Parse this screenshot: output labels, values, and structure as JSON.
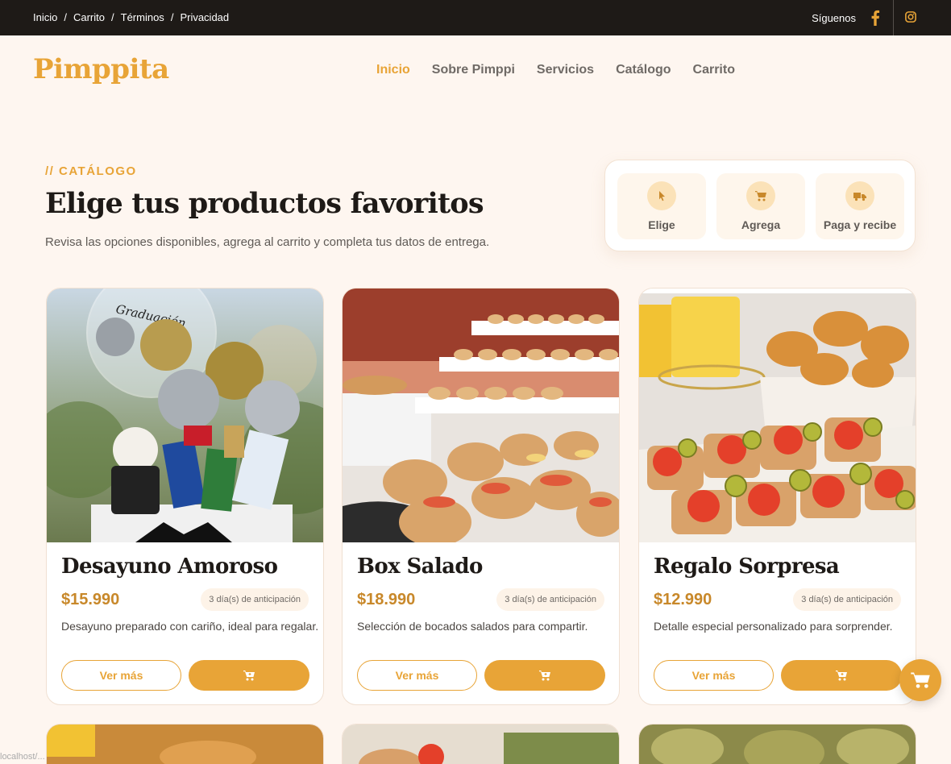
{
  "topbar": {
    "breadcrumbs": [
      "Inicio",
      "Carrito",
      "Términos",
      "Privacidad"
    ],
    "follow_label": "Síguenos",
    "social_icons": [
      "facebook-icon",
      "instagram-icon"
    ]
  },
  "brand": {
    "name": "Pimppita"
  },
  "nav": {
    "items": [
      "Inicio",
      "Sobre Pimppi",
      "Servicios",
      "Catálogo",
      "Carrito"
    ],
    "active": "Inicio"
  },
  "hero": {
    "eyebrow": "// CATÁLOGO",
    "title": "Elige tus productos favoritos",
    "subtitle": "Revisa las opciones disponibles, agrega al carrito y completa tus datos de entrega."
  },
  "steps": [
    {
      "label": "Elige",
      "icon": "pointer-icon"
    },
    {
      "label": "Agrega",
      "icon": "cart-icon"
    },
    {
      "label": "Paga y recibe",
      "icon": "truck-icon"
    }
  ],
  "products": [
    {
      "name": "Desayuno Amoroso",
      "price": "$15.990",
      "lead_time": "3 día(s) de anticipación",
      "description": "Desayuno preparado con cariño, ideal para regalar.",
      "more_label": "Ver más"
    },
    {
      "name": "Box Salado",
      "price": "$18.990",
      "lead_time": "3 día(s) de anticipación",
      "description": "Selección de bocados salados para compartir.",
      "more_label": "Ver más"
    },
    {
      "name": "Regalo Sorpresa",
      "price": "$12.990",
      "lead_time": "3 día(s) de anticipación",
      "description": "Detalle especial personalizado para sorprender.",
      "more_label": "Ver más"
    }
  ],
  "photo_caption": "Graduación",
  "status_url": "localhost/...",
  "colors": {
    "accent": "#e8a437",
    "dark": "#1e1a17",
    "background": "#fef6f0"
  }
}
